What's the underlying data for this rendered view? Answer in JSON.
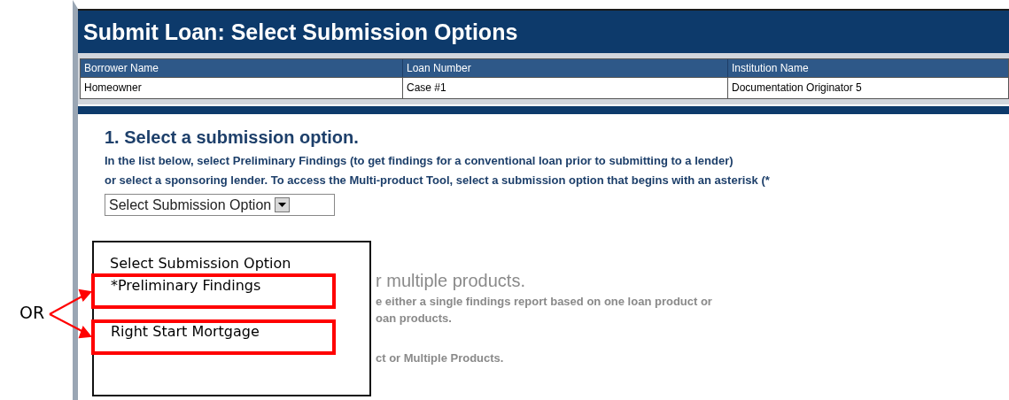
{
  "window": {
    "title": "Submit Loan: Select Submission Options"
  },
  "loan_table": {
    "columns": [
      "Borrower Name",
      "Loan Number",
      "Institution Name"
    ],
    "rows": [
      [
        "Homeowner",
        "Case #1",
        "Documentation Originator 5"
      ]
    ]
  },
  "step_1": {
    "heading": "1. Select a submission option.",
    "instructions": [
      "In the list below, select Preliminary Findings (to get findings for a conventional loan prior to submitting to a lender)",
      "or select a sponsoring lender. To access the Multi-product Tool, select a submission option that begins with an asterisk (*"
    ],
    "dropdown": {
      "value": "Select Submission Option"
    }
  },
  "step_2_visible": {
    "heading": "r multiple products.",
    "lines": [
      "e either a single findings report based on one loan product or",
      "oan products.",
      "ct or Multiple Products."
    ]
  },
  "callout": {
    "connector_label": "OR",
    "options": [
      {
        "label": "Select Submission Option",
        "highlighted": false
      },
      {
        "label": "*Preliminary Findings",
        "highlighted": true
      },
      {
        "label": "Right Start Mortgage",
        "highlighted": true
      }
    ]
  }
}
